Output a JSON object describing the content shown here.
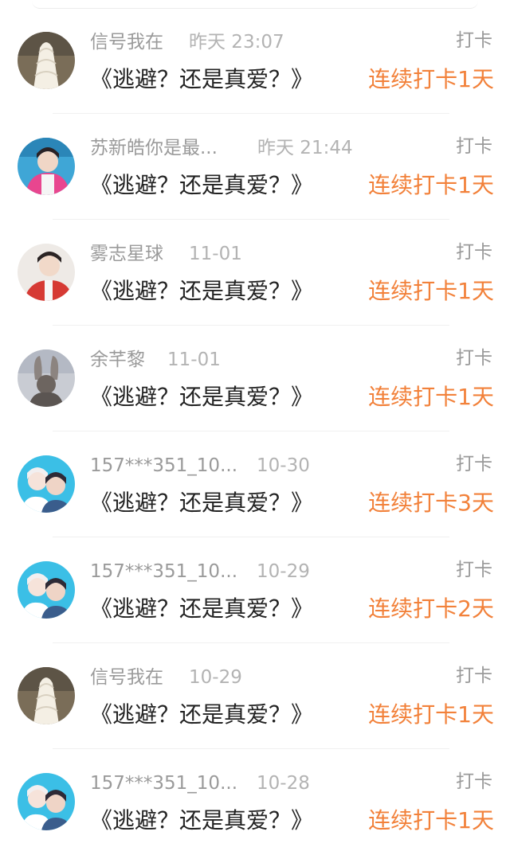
{
  "colors": {
    "accent_orange": "#f2813a",
    "meta_gray": "#9a9a9a",
    "title_black": "#222222"
  },
  "entries": [
    {
      "user": "信号我在",
      "time": "昨天 23:07",
      "tag": "打卡",
      "title": "《逃避？还是真爱？》",
      "streak": "连续打卡1天",
      "avatar": "ice-cream-avatar"
    },
    {
      "user": "苏新皓你是最...",
      "time": "昨天 21:44",
      "tag": "打卡",
      "title": "《逃避？还是真爱？》",
      "streak": "连续打卡1天",
      "avatar": "pink-jacket-avatar"
    },
    {
      "user": "雾志星球",
      "time": "11-01",
      "tag": "打卡",
      "title": "《逃避？还是真爱？》",
      "streak": "连续打卡1天",
      "avatar": "red-shirt-avatar"
    },
    {
      "user": "余芊黎",
      "time": "11-01",
      "tag": "打卡",
      "title": "《逃避？还是真爱？》",
      "streak": "连续打卡1天",
      "avatar": "bunny-ears-avatar"
    },
    {
      "user": "157***351_10...",
      "time": "10-30",
      "tag": "打卡",
      "title": "《逃避？还是真爱？》",
      "streak": "连续打卡3天",
      "avatar": "two-boys-avatar"
    },
    {
      "user": "157***351_10...",
      "time": "10-29",
      "tag": "打卡",
      "title": "《逃避？还是真爱？》",
      "streak": "连续打卡2天",
      "avatar": "two-boys-avatar"
    },
    {
      "user": "信号我在",
      "time": "10-29",
      "tag": "打卡",
      "title": "《逃避？还是真爱？》",
      "streak": "连续打卡1天",
      "avatar": "ice-cream-avatar"
    },
    {
      "user": "157***351_10...",
      "time": "10-28",
      "tag": "打卡",
      "title": "《逃避？还是真爱？》",
      "streak": "连续打卡1天",
      "avatar": "two-boys-avatar"
    }
  ]
}
